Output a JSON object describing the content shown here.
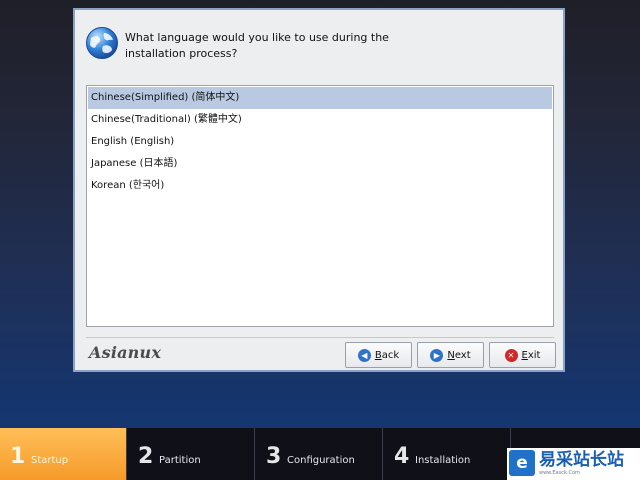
{
  "dialog": {
    "question": "What language would you like to use during the installation process?",
    "languages": [
      {
        "label": "Chinese(Simplified) (简体中文)",
        "selected": true
      },
      {
        "label": "Chinese(Traditional) (繁體中文)",
        "selected": false
      },
      {
        "label": "English (English)",
        "selected": false
      },
      {
        "label": "Japanese (日本語)",
        "selected": false
      },
      {
        "label": "Korean (한국어)",
        "selected": false
      }
    ],
    "logo_text": "Asianux",
    "buttons": {
      "back": "Back",
      "next": "Next",
      "exit": "Exit"
    },
    "icons": {
      "header": "globe-icon",
      "back": "back-arrow-icon",
      "next": "next-arrow-icon",
      "exit": "exit-x-icon"
    }
  },
  "steps": [
    {
      "number": "1",
      "label": "Startup",
      "active": true
    },
    {
      "number": "2",
      "label": "Partition",
      "active": false
    },
    {
      "number": "3",
      "label": "Configuration",
      "active": false
    },
    {
      "number": "4",
      "label": "Installation",
      "active": false
    }
  ],
  "watermark": {
    "text": "易采站长站",
    "url": "www.Easck.Com"
  },
  "colors": {
    "accent_step": "#f59a2a",
    "selection": "#b9c9e1",
    "brand_blue": "#1a5fb4"
  }
}
